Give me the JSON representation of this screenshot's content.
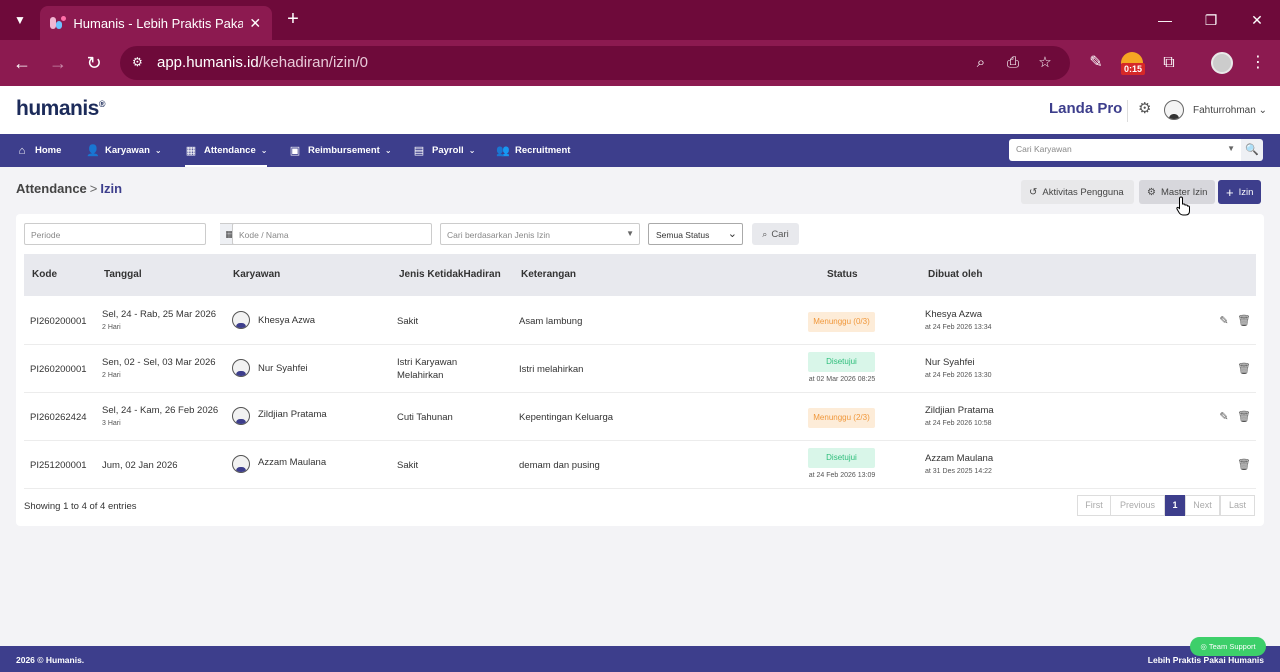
{
  "browser": {
    "tab_title": "Humanis - Lebih Praktis Pakai Humanis",
    "url_host": "app.humanis.id",
    "url_path": "/kehadiran/izin/0",
    "timer_badge": "0:15"
  },
  "header": {
    "logo": "humanis",
    "logo_mark": "®",
    "plan": "Landa Pro",
    "user_name": "Fahturrohman"
  },
  "menu": {
    "items": [
      {
        "label": "Home",
        "icon": "home-icon"
      },
      {
        "label": "Karyawan",
        "icon": "user-check-icon"
      },
      {
        "label": "Attendance",
        "icon": "calendar-icon"
      },
      {
        "label": "Reimbursement",
        "icon": "money-icon"
      },
      {
        "label": "Payroll",
        "icon": "wallet-icon"
      },
      {
        "label": "Recruitment",
        "icon": "users-icon"
      }
    ],
    "active": "Attendance",
    "search_placeholder": "Cari Karyawan"
  },
  "breadcrumb": {
    "parent": "Attendance",
    "separator": ">",
    "current": "Izin"
  },
  "actions": {
    "aktivitas": "Aktivitas Pengguna",
    "master": "Master Izin",
    "add": "Izin"
  },
  "filters": {
    "periode_placeholder": "Periode",
    "kode_placeholder": "Kode / Nama",
    "jenis_placeholder": "Cari berdasarkan Jenis Izin",
    "status_selected": "Semua Status",
    "search_button": "Cari"
  },
  "table": {
    "headers": [
      "Kode",
      "Tanggal",
      "Karyawan",
      "Jenis KetidakHadiran",
      "Keterangan",
      "Status",
      "Dibuat oleh"
    ],
    "rows": [
      {
        "kode": "PI260200001",
        "tanggal": "Sel, 24 - Rab, 25 Mar 2026",
        "durasi": "2 Hari",
        "karyawan": "Khesya Azwa",
        "jenis": "Sakit",
        "jenis2": "",
        "keterangan": "Asam lambung",
        "status": "Menunggu (0/3)",
        "status_sub": "",
        "dibuat": "Khesya Azwa",
        "dibuat_at": "at 24 Feb 2026 13:34"
      },
      {
        "kode": "PI260200001",
        "tanggal": "Sen, 02 - Sel, 03 Mar 2026",
        "durasi": "2 Hari",
        "karyawan": "Nur Syahfei",
        "jenis": "Istri Karyawan",
        "jenis2": "Melahirkan",
        "keterangan": "Istri melahirkan",
        "status": "Disetujui",
        "status_sub": "at 02 Mar 2026 08:25",
        "dibuat": "Nur Syahfei",
        "dibuat_at": "at 24 Feb 2026 13:30"
      },
      {
        "kode": "PI260262424",
        "tanggal": "Sel, 24 - Kam, 26 Feb 2026",
        "durasi": "3 Hari",
        "karyawan": "Zildjian Pratama",
        "jenis": "Cuti Tahunan",
        "jenis2": "",
        "keterangan": "Kepentingan Keluarga",
        "status": "Menunggu (2/3)",
        "status_sub": "",
        "dibuat": "Zildjian Pratama",
        "dibuat_at": "at 24 Feb 2026 10:58"
      },
      {
        "kode": "PI251200001",
        "tanggal": "Jum, 02 Jan 2026",
        "durasi": "",
        "karyawan": "Azzam Maulana",
        "jenis": "Sakit",
        "jenis2": "",
        "keterangan": "demam dan pusing",
        "status": "Disetujui",
        "status_sub": "at 24 Feb 2026 13:09",
        "dibuat": "Azzam Maulana",
        "dibuat_at": "at 31 Des 2025 14:22"
      }
    ],
    "showing": "Showing 1 to 4 of 4 entries"
  },
  "pagination": {
    "first": "First",
    "previous": "Previous",
    "page": "1",
    "next": "Next",
    "last": "Last"
  },
  "footer": {
    "copyright": "2026 © Humanis.",
    "tagline": "Lebih Praktis Pakai Humanis",
    "support": "Team Support"
  },
  "colors": {
    "brand": "#3d3e8c",
    "browser": "#8c1a50",
    "waiting": "#f0973a",
    "approved": "#2dbd7a"
  }
}
